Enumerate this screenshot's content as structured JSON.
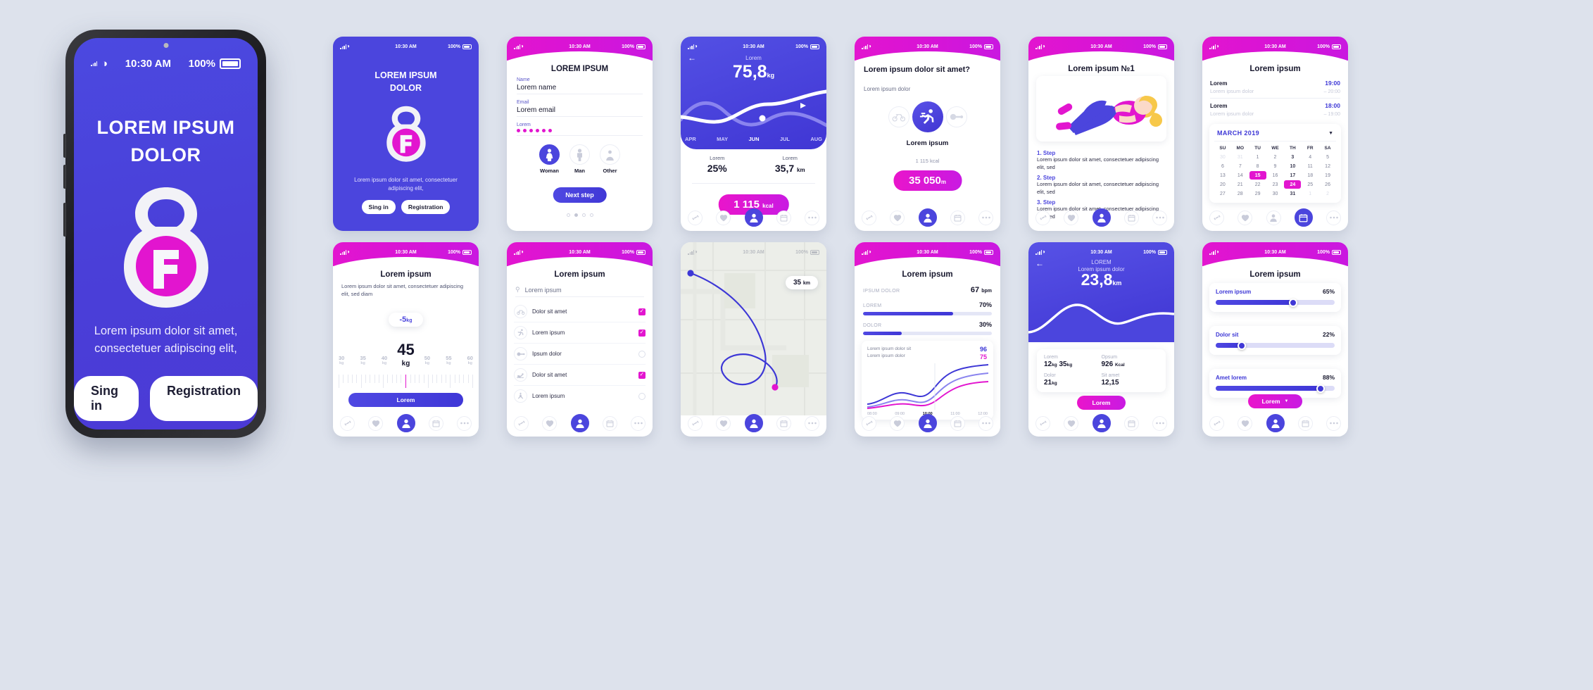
{
  "brand": {
    "accent_blue": "#4b45dd",
    "accent_magenta": "#e215cf",
    "bg": "#dde2ec"
  },
  "status_bar": {
    "time": "10:30 AM",
    "battery": "100%",
    "signal_icon": "signal-bars-icon",
    "wifi_icon": "wifi-icon",
    "battery_icon": "battery-icon"
  },
  "big_phone": {
    "status": {
      "time": "10:30 AM",
      "battery": "100%"
    },
    "title_line1": "LOREM IPSUM",
    "title_line2": "DOLOR",
    "logo_icon": "kettlebell-logo-icon",
    "subtitle": "Lorem ipsum dolor sit amet, consectetuer adipiscing elit,",
    "sign_in": "Sing in",
    "registration": "Registration"
  },
  "screens": [
    {
      "id": "splash",
      "header_style": "blue",
      "title_line1": "LOREM IPSUM",
      "title_line2": "DOLOR",
      "logo_icon": "kettlebell-logo-icon",
      "subtitle": "Lorem ipsum dolor sit amet, consectetuer adipiscing elit,",
      "sign_in": "Sing in",
      "registration": "Registration"
    },
    {
      "id": "registration-form",
      "header_style": "pink",
      "title": "LOREM IPSUM",
      "fields": [
        {
          "label": "Name",
          "value": "Lorem name"
        },
        {
          "label": "Email",
          "value": "Lorem email"
        },
        {
          "label": "Lorem",
          "value": "••••••",
          "type": "password",
          "dots": 6
        }
      ],
      "gender": [
        {
          "label": "Woman",
          "icon": "woman-icon",
          "selected": true
        },
        {
          "label": "Man",
          "icon": "man-icon",
          "selected": false
        },
        {
          "label": "Other",
          "icon": "other-person-icon",
          "selected": false
        }
      ],
      "next_button": "Next step",
      "pager": {
        "count": 4,
        "active_index": 1
      }
    },
    {
      "id": "weight-progress",
      "header_style": "blue",
      "back_icon": "arrow-left-icon",
      "metric_label": "Lorem",
      "metric_value": "75,8",
      "metric_unit": "kg",
      "months": [
        "APR",
        "MAY",
        "JUN",
        "JUL",
        "AUG"
      ],
      "active_month": "JUN",
      "stats": [
        {
          "label": "Lorem",
          "value": "25%",
          "unit": ""
        },
        {
          "label": "Lorem",
          "value": "35,7",
          "unit": "km"
        }
      ],
      "kcal_pill": {
        "value": "1 115",
        "unit": "kcal"
      }
    },
    {
      "id": "activity-select",
      "header_style": "pink",
      "title": "Lorem ipsum dolor sit amet?",
      "subtitle": "Lorem ipsum dolor",
      "activities": [
        {
          "icon": "bicycle-icon",
          "selected": false
        },
        {
          "icon": "runner-icon",
          "selected": true
        },
        {
          "icon": "dumbbell-icon",
          "selected": false
        }
      ],
      "caption": "Lorem ipsum",
      "kcal_text": "1 115 kcal",
      "distance_pill": {
        "value": "35 050",
        "unit": "m"
      }
    },
    {
      "id": "exercise-steps",
      "header_style": "pink",
      "title": "Lorem ipsum №1",
      "illustration_icon": "woman-stretching-illustration",
      "steps": [
        {
          "heading": "1. Step",
          "text": "Lorem ipsum dolor sit amet, consectetuer adipiscing elit, sed"
        },
        {
          "heading": "2. Step",
          "text": "Lorem ipsum dolor sit amet, consectetuer adipiscing elit, sed"
        },
        {
          "heading": "3. Step",
          "text": "Lorem ipsum dolor sit amet, consectetuer adipiscing elit, sed"
        }
      ]
    },
    {
      "id": "calendar",
      "header_style": "pink",
      "title": "Lorem ipsum",
      "events": [
        {
          "name": "Lorem",
          "time": "19:00",
          "sub": "Lorem ipsum dolor",
          "sub_time": "– 20:00"
        },
        {
          "name": "Lorem",
          "time": "18:00",
          "sub": "Lorem ipsum dolor",
          "sub_time": "– 19:00"
        }
      ],
      "month_label": "MARCH  2019",
      "chevron_icon": "chevron-down-icon",
      "weekdays": [
        "SU",
        "MO",
        "TU",
        "WE",
        "TH",
        "FR",
        "SA"
      ],
      "days": [
        [
          {
            "d": "30",
            "s": "mute"
          },
          {
            "d": "31",
            "s": "mute"
          },
          {
            "d": "1",
            "s": "dim"
          },
          {
            "d": "2",
            "s": "dim"
          },
          {
            "d": "3",
            "s": ""
          },
          {
            "d": "4",
            "s": "dim"
          },
          {
            "d": "5",
            "s": "dim"
          }
        ],
        [
          {
            "d": "6",
            "s": "dim"
          },
          {
            "d": "7",
            "s": "dim"
          },
          {
            "d": "8",
            "s": "dim"
          },
          {
            "d": "9",
            "s": "dim"
          },
          {
            "d": "10",
            "s": ""
          },
          {
            "d": "11",
            "s": "dim"
          },
          {
            "d": "12",
            "s": "dim"
          }
        ],
        [
          {
            "d": "13",
            "s": "dim"
          },
          {
            "d": "14",
            "s": "dim"
          },
          {
            "d": "15",
            "s": "sel"
          },
          {
            "d": "16",
            "s": "dim"
          },
          {
            "d": "17",
            "s": ""
          },
          {
            "d": "18",
            "s": "dim"
          },
          {
            "d": "19",
            "s": "dim"
          }
        ],
        [
          {
            "d": "20",
            "s": "dim"
          },
          {
            "d": "21",
            "s": "dim"
          },
          {
            "d": "22",
            "s": "dim"
          },
          {
            "d": "23",
            "s": "dim"
          },
          {
            "d": "24",
            "s": "sel"
          },
          {
            "d": "25",
            "s": "dim"
          },
          {
            "d": "26",
            "s": "dim"
          }
        ],
        [
          {
            "d": "27",
            "s": "dim"
          },
          {
            "d": "28",
            "s": "dim"
          },
          {
            "d": "29",
            "s": "dim"
          },
          {
            "d": "30",
            "s": "dim"
          },
          {
            "d": "31",
            "s": ""
          },
          {
            "d": "1",
            "s": "mute"
          },
          {
            "d": "2",
            "s": "mute"
          }
        ]
      ]
    },
    {
      "id": "weight-picker",
      "header_style": "pink",
      "title": "Lorem ipsum",
      "paragraph": "Lorem ipsum dolor sit amet, consectetuer adipiscing elit, sed diam",
      "delta_chip": {
        "value": "-5",
        "unit": "kg"
      },
      "weight_value": "45",
      "weight_unit": "kg",
      "scale_labels": [
        "30",
        "35",
        "40",
        "45",
        "50",
        "55",
        "60"
      ],
      "scale_unit": "kg",
      "button": "Lorem"
    },
    {
      "id": "exercise-list",
      "header_style": "pink",
      "title": "Lorem ipsum",
      "search": {
        "icon": "search-icon",
        "placeholder": "Lorem  ipsum"
      },
      "items": [
        {
          "icon": "bicycle-icon",
          "label": "Dolor sit amet",
          "checked": true
        },
        {
          "icon": "runner-icon",
          "label": "Lorem ipsum",
          "checked": true
        },
        {
          "icon": "dumbbell-icon",
          "label": "Ipsum dolor",
          "checked": false
        },
        {
          "icon": "swimmer-icon",
          "label": "Dolor sit amet",
          "checked": true
        },
        {
          "icon": "yoga-icon",
          "label": "Lorem ipsum",
          "checked": false
        }
      ]
    },
    {
      "id": "route-map",
      "header_style": "map",
      "distance_chip": {
        "value": "35",
        "unit": "km"
      },
      "start_marker": "route-start-marker",
      "end_marker": "route-end-marker"
    },
    {
      "id": "health-stats",
      "header_style": "pink",
      "title": "Lorem ipsum",
      "rows": [
        {
          "label": "IPSUM DOLOR",
          "value": "67",
          "unit": "bpm",
          "bar": null
        },
        {
          "label": "LOREM",
          "value": "70%",
          "unit": "",
          "bar": 70
        },
        {
          "label": "DOLOR",
          "value": "30%",
          "unit": "",
          "bar": 30
        }
      ],
      "chart_card": {
        "caption_line1": "Lorem ipsum dolor sit",
        "caption_line2": "Lorem ipsum dolor",
        "value_blue": "96",
        "value_pink": "75",
        "x_labels": [
          "08:00",
          "09:00",
          "10:00",
          "11:00",
          "12:00"
        ],
        "x_active": "10:00"
      }
    },
    {
      "id": "run-summary",
      "header_style": "blue",
      "back_icon": "arrow-left-icon",
      "label_top": "LOREM",
      "label_sub": "Lorem ipsum dolor",
      "label_overlap": "Lorem ipsum",
      "distance_value": "23,8",
      "distance_unit": "km",
      "metrics": [
        {
          "label": "Lorem",
          "value": "12",
          "unit": "kg",
          "label2": "35",
          "unit2": "kg"
        },
        {
          "label": "Opsum",
          "value": "926",
          "unit": "Kcal"
        },
        {
          "label": "Dolor",
          "value": "21",
          "unit": "kg"
        },
        {
          "label": "Sit amet",
          "value": "12,15",
          "unit": ""
        }
      ],
      "button": "Lorem"
    },
    {
      "id": "goal-sliders",
      "header_style": "pink",
      "title": "Lorem ipsum",
      "sliders": [
        {
          "label": "Lorem ipsum",
          "percent": "65%",
          "value": 65
        },
        {
          "label": "Dolor sit",
          "percent": "22%",
          "value": 22
        },
        {
          "label": "Amet lorem",
          "percent": "88%",
          "value": 88
        }
      ],
      "button": "Lorem",
      "button_icon": "chevron-down-icon"
    }
  ],
  "bottom_nav": {
    "items": [
      {
        "icon": "dumbbell-icon",
        "active": false
      },
      {
        "icon": "heart-icon",
        "active": false
      },
      {
        "icon": "user-icon",
        "active": true
      },
      {
        "icon": "calendar-icon",
        "active": false
      },
      {
        "icon": "ellipsis-icon",
        "active": false
      }
    ]
  }
}
